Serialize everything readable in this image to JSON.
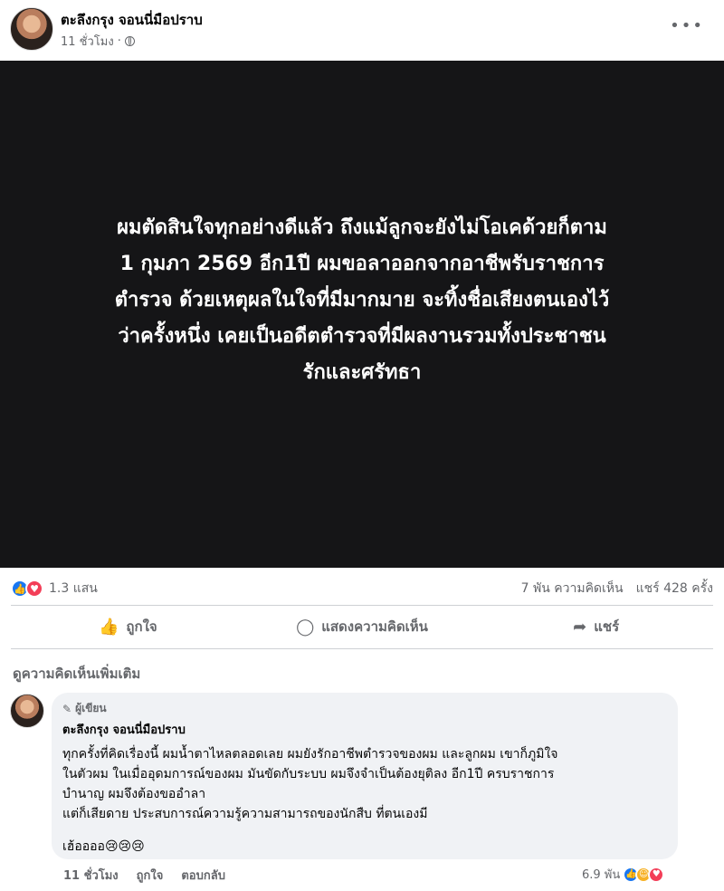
{
  "post": {
    "author": "ตะลึงกรุง จอนนี่มือปราบ",
    "time": "11 ชั่วโมง",
    "dot": "·",
    "image_text_lines": [
      "ผมตัดสินใจทุกอย่างดีแล้ว ถึงแม้ลูกจะยังไม่โอเคด้วยก็ตาม",
      "1 กุมภา 2569 อีก1ปี ผมขอลาออกจากอาชีพรับราชการ",
      "ตำรวจ ด้วยเหตุผลในใจที่มีมากมาย จะทิ้งชื่อเสียงตนเองไว้",
      "ว่าครั้งหนึ่ง เคยเป็นอดีตตำรวจที่มีผลงานรวมทั้งประชาชน",
      "รักและศรัทธา"
    ]
  },
  "stats": {
    "reactions": "1.3 แสน",
    "comments": "7 พัน ความคิดเห็น",
    "shares": "แชร์ 428 ครั้ง"
  },
  "actions": {
    "like": "ถูกใจ",
    "comment": "แสดงความคิดเห็น",
    "share": "แชร์"
  },
  "more_comments": "ดูความคิดเห็นเพิ่มเติม",
  "comment": {
    "badge": "ผู้เขียน",
    "author": "ตะลึงกรุง จอนนี่มือปราบ",
    "lines": [
      "ทุกครั้งที่คิดเรื่องนี้ ผมน้ำตาไหลตลอดเลย ผมยังรักอาชีพตำรวจของผม และลูกผม เขาก็ภูมิใจ",
      "ในตัวผม ในเมื่ออุดมการณ์ของผม มันขัดกับระบบ ผมจึงจำเป็นต้องยุติลง อีก1ปี ครบราชการ",
      "บำนาญ ผมจึงต้องขออำลา",
      "แต่ก็เสียดาย ประสบการณ์ความรู้ความสามารถของนักสืบ ที่ตนเองมี"
    ],
    "last_line": "เฮ้ออออ😢😢😢",
    "time": "11 ชั่วโมง",
    "like": "ถูกใจ",
    "reply": "ตอบกลับ",
    "reactions": "6.9 พัน"
  },
  "icons": {
    "more": "more-horizontal-icon",
    "globe": "globe-icon",
    "like": "thumbs-up-icon",
    "comment": "comment-bubble-icon",
    "share": "share-arrow-icon"
  },
  "colors": {
    "like_blue": "#1877f2",
    "love_red": "#f33e58",
    "image_bg": "#151517"
  }
}
